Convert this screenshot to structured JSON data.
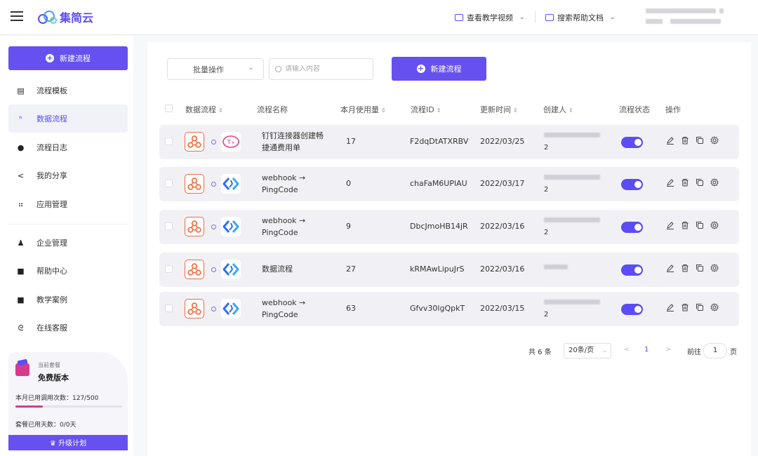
{
  "header": {
    "app_name": "集简云",
    "links": [
      {
        "label": "查看教学视频",
        "icon": "video-icon"
      },
      {
        "label": "搜索帮助文档",
        "icon": "doc-icon"
      }
    ]
  },
  "sidebar": {
    "new_button": "新建流程",
    "items": [
      {
        "label": "流程模板",
        "icon": "template-icon"
      },
      {
        "label": "数据流程",
        "icon": "flow-icon",
        "active": true
      },
      {
        "label": "流程日志",
        "icon": "log-icon"
      },
      {
        "label": "我的分享",
        "icon": "share-icon"
      },
      {
        "label": "应用管理",
        "icon": "apps-icon"
      },
      {
        "label": "企业管理",
        "icon": "enterprise-icon"
      },
      {
        "label": "帮助中心",
        "icon": "help-icon"
      },
      {
        "label": "教学案例",
        "icon": "case-icon"
      },
      {
        "label": "在线客服",
        "icon": "headset-icon"
      }
    ],
    "plan": {
      "label": "当前套餐",
      "name": "免费版本",
      "usage_text": "本月已用调用次数：127/500",
      "usage_fraction": 0.254,
      "days_text": "套餐已用天数：0/0天",
      "upgrade_label": "升级计划"
    }
  },
  "toolbar": {
    "bulk_select": "批量操作",
    "search_placeholder": "请输入内容",
    "new_button": "新建流程"
  },
  "table": {
    "columns": [
      "数据流程",
      "流程名称",
      "本月使用量",
      "流程ID",
      "更新时间",
      "创建人",
      "流程状态",
      "操作"
    ],
    "rows": [
      {
        "name": "钉钉连接器创建畅捷通费用单",
        "usage": "17",
        "id": "F2dqDtATXRBV",
        "updated": "2022/03/25",
        "creator_tail": "2",
        "target": "chanjet",
        "enabled": true
      },
      {
        "name": "webhook → PingCode",
        "usage": "0",
        "id": "chaFaM6UPlAU",
        "updated": "2022/03/17",
        "creator_tail": "2",
        "target": "pingcode",
        "enabled": true
      },
      {
        "name": "webhook → PingCode",
        "usage": "9",
        "id": "DbcJmoHB14jR",
        "updated": "2022/03/16",
        "creator_tail": "2",
        "target": "pingcode",
        "enabled": true
      },
      {
        "name": "数据流程",
        "usage": "27",
        "id": "kRMAwLipuJrS",
        "updated": "2022/03/16",
        "creator_tail": "",
        "target": "pingcode",
        "enabled": true
      },
      {
        "name": "webhook → PingCode",
        "usage": "63",
        "id": "Gfvv30lgQpkT",
        "updated": "2022/03/15",
        "creator_tail": "2",
        "target": "pingcode",
        "enabled": true
      }
    ]
  },
  "pagination": {
    "total": "共 6 条",
    "page_size": "20条/页",
    "prev": "<",
    "current": "1",
    "next": ">",
    "goto_label": "前往",
    "goto_value": "1",
    "goto_suffix": "页"
  },
  "colors": {
    "accent": "#6651f0",
    "hook": "#f06b42",
    "pingcode": "#2f6ff0",
    "plan_bar": "#d63a8c"
  }
}
